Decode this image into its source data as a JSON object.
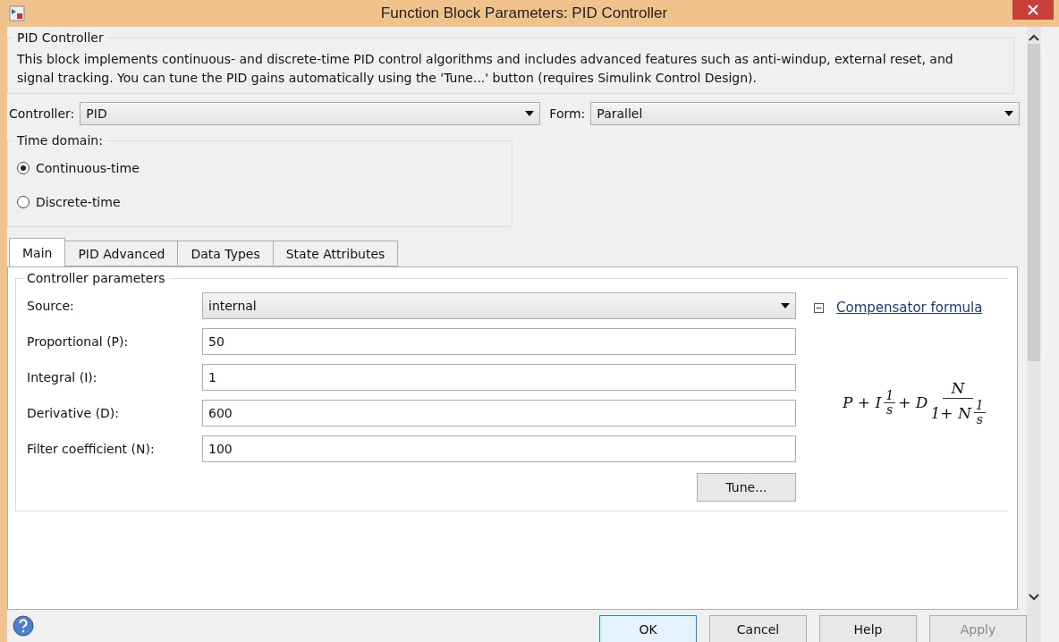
{
  "window": {
    "title": "Function Block Parameters: PID Controller"
  },
  "block": {
    "name": "PID Controller",
    "description": "This block implements continuous- and discrete-time PID control algorithms and includes advanced features such as anti-windup, external reset, and signal tracking. You can tune the PID gains automatically using the 'Tune...' button (requires Simulink Control Design)."
  },
  "controller": {
    "label": "Controller:",
    "value": "PID"
  },
  "form": {
    "label": "Form:",
    "value": "Parallel"
  },
  "time_domain": {
    "title": "Time domain:",
    "options": [
      {
        "label": "Continuous-time",
        "selected": true
      },
      {
        "label": "Discrete-time",
        "selected": false
      }
    ]
  },
  "tabs": [
    {
      "label": "Main",
      "selected": true
    },
    {
      "label": "PID Advanced",
      "selected": false
    },
    {
      "label": "Data Types",
      "selected": false
    },
    {
      "label": "State Attributes",
      "selected": false
    }
  ],
  "controller_parameters": {
    "title": "Controller parameters",
    "fields": [
      {
        "kind": "dropdown",
        "label": "Source:",
        "value": "internal"
      },
      {
        "kind": "text",
        "label": "Proportional (P):",
        "value": "50"
      },
      {
        "kind": "text",
        "label": "Integral (I):",
        "value": "1"
      },
      {
        "kind": "text",
        "label": "Derivative (D):",
        "value": "600"
      },
      {
        "kind": "text",
        "label": "Filter coefficient (N):",
        "value": "100"
      }
    ],
    "tune_button": "Tune..."
  },
  "compensator": {
    "link": "Compensator formula",
    "expanded": true,
    "formula": {
      "lead": "P + I",
      "f1_num": "1",
      "f1_den": "s",
      "mid": "+ D",
      "num": "N",
      "den_lead": "1+ N",
      "f2_num": "1",
      "f2_den": "s"
    }
  },
  "buttons": [
    {
      "label": "OK",
      "disabled": false,
      "default": true
    },
    {
      "label": "Cancel",
      "disabled": false,
      "default": false
    },
    {
      "label": "Help",
      "disabled": false,
      "default": false
    },
    {
      "label": "Apply",
      "disabled": true,
      "default": false
    }
  ]
}
